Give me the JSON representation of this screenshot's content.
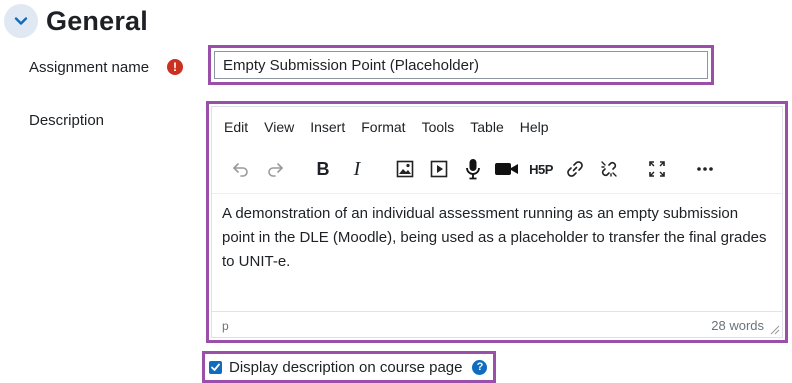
{
  "section": {
    "title": "General",
    "icon": "chevron-down-icon"
  },
  "fields": {
    "assignment_name": {
      "label": "Assignment name",
      "value": "Empty Submission Point (Placeholder)",
      "required_icon": "!"
    },
    "description": {
      "label": "Description",
      "menu": [
        "Edit",
        "View",
        "Insert",
        "Format",
        "Tools",
        "Table",
        "Help"
      ],
      "toolbar": [
        "undo-icon",
        "redo-icon",
        "bold-icon",
        "italic-icon",
        "image-icon",
        "media-icon",
        "microphone-icon",
        "video-camera-icon",
        "h5p-icon",
        "link-icon",
        "unlink-icon",
        "fullscreen-icon",
        "more-icon"
      ],
      "bold_glyph": "B",
      "italic_glyph": "I",
      "h5p_text": "H5P",
      "content": "A demonstration of an individual assessment running as an empty submission point in the DLE (Moodle), being used as a placeholder to transfer the final grades to UNIT-e.",
      "status_path": "p",
      "word_count": "28 words"
    },
    "display_description": {
      "label": "Display description on course page",
      "checked": true,
      "help_icon": "?"
    }
  },
  "colors": {
    "highlight_outline": "#9a4fa8",
    "required": "#ca3120",
    "accent": "#0f6cbf",
    "collapse_bg": "#e0e8f4"
  }
}
